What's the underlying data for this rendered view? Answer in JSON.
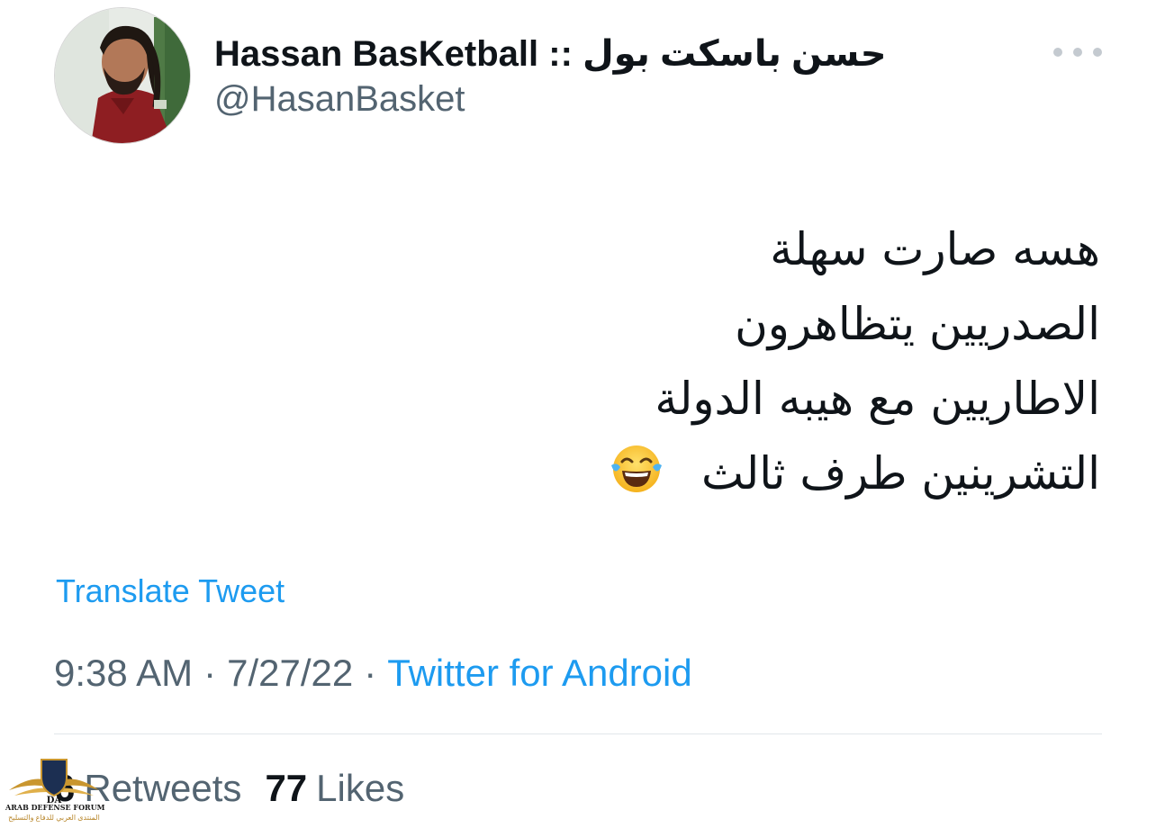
{
  "user": {
    "display_name": "Hassan BasKetball :: حسن باسكت بول",
    "handle": "@HasanBasket"
  },
  "tweet": {
    "lines": [
      "هسه صارت سهلة",
      "الصدريين يتظاهرون",
      "الاطاريين مع هيبه الدولة",
      "التشرينين طرف ثالث"
    ],
    "emoji_icon": "face-with-tears-of-joy-icon",
    "translate_label": "Translate Tweet",
    "time": "9:38 AM",
    "date": "7/27/22",
    "separator": "·",
    "source": "Twitter for Android"
  },
  "stats": {
    "retweets_count": "6",
    "retweets_label": "Retweets",
    "likes_count": "77",
    "likes_label": "Likes"
  },
  "watermark": {
    "logo_text": "DA",
    "title": "ARAB DEFENSE FORUM",
    "subtitle": "المنتدى العربي للدفاع والتسليح"
  },
  "colors": {
    "link": "#1d9bf0",
    "secondary_text": "#536471",
    "primary_text": "#0f1419",
    "divider": "#e1e6ea"
  }
}
